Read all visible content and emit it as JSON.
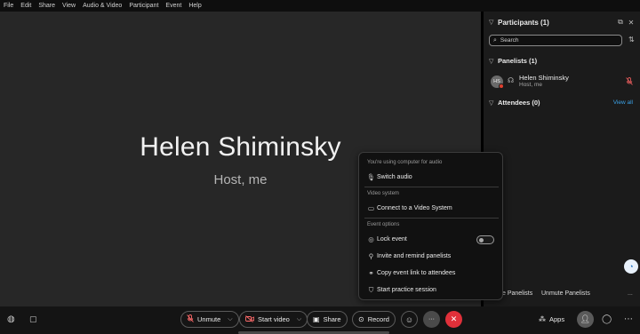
{
  "menu": [
    "File",
    "Edit",
    "Share",
    "View",
    "Audio & Video",
    "Participant",
    "Event",
    "Help"
  ],
  "stage": {
    "name": "Helen Shiminsky",
    "subtitle": "Host, me"
  },
  "panel": {
    "title": "Participants (1)",
    "search_placeholder": "Search",
    "panelists_header": "Panelists (1)",
    "panelist": {
      "initials": "HS",
      "name": "Helen Shiminsky",
      "role": "Host, me"
    },
    "attendees_header": "Attendees (0)",
    "view_all": "View all",
    "bottom_left": "e Panelists",
    "bottom_right": "Unmute Panelists",
    "more": "..."
  },
  "popup": {
    "audio_label": "You're using computer for audio",
    "switch_audio": "Switch audio",
    "video_label": "Video system",
    "connect_video": "Connect to a Video System",
    "event_label": "Event options",
    "lock_event": "Lock event",
    "invite": "Invite and remind panelists",
    "copy_link": "Copy event link to attendees",
    "practice": "Start practice session"
  },
  "toolbar": {
    "unmute": "Unmute",
    "start_video": "Start video",
    "share": "Share",
    "record": "Record",
    "more": "···",
    "apps": "Apps"
  },
  "colors": {
    "accent": "#3ba3e8",
    "end_call": "#e0303a",
    "mute_red": "#ff6b6b"
  }
}
